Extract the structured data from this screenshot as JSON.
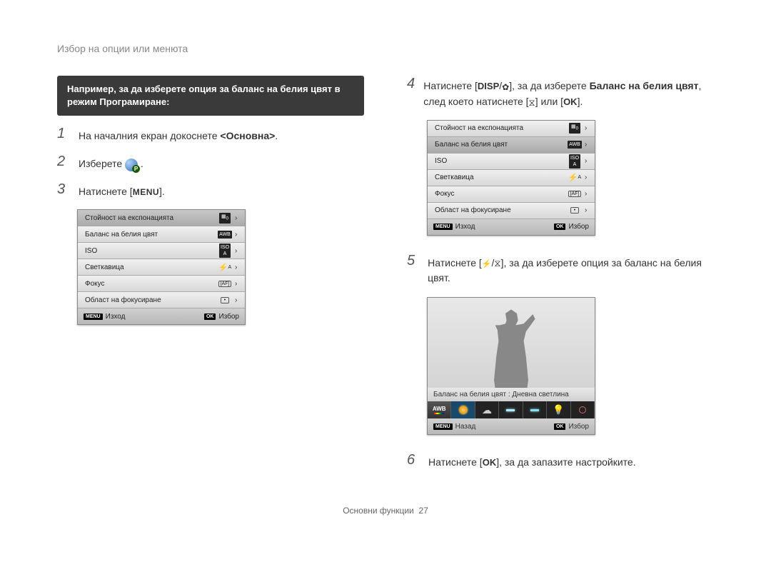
{
  "header": "Избор на опции или менюта",
  "note": "Например, за да изберете опция за баланс на белия цвят в режим Програмиране:",
  "steps": {
    "s1": {
      "num": "1",
      "text_a": "На началния екран докоснете ",
      "bold": "<Основна>",
      "text_b": "."
    },
    "s2": {
      "num": "2",
      "text_a": "Изберете ",
      "text_b": "."
    },
    "s3": {
      "num": "3",
      "text_a": "Натиснете [",
      "menu": "MENU",
      "text_b": "]."
    },
    "s4": {
      "num": "4",
      "text_a": "Натиснете [",
      "disp": "DISP",
      "slash": "/",
      "text_b": "], за да изберете ",
      "bold": "Баланс на белия цвят",
      "text_c": ", след което натиснете [",
      "text_d": "] или [",
      "ok": "OK",
      "text_e": "]."
    },
    "s5": {
      "num": "5",
      "text_a": "Натиснете [",
      "slash": "/",
      "text_b": "], за да изберете опция за баланс на белия цвят."
    },
    "s6": {
      "num": "6",
      "text_a": "Натиснете [",
      "ok": "OK",
      "text_b": "], за да запазите настройките."
    }
  },
  "menu": {
    "r1": "Стойност на експонацията",
    "r2": "Баланс на белия цвят",
    "r3": "ISO",
    "r4": "Светкавица",
    "r5": "Фокус",
    "r6": "Област на фокусиране",
    "v3": "ISO",
    "v_auto_sup": "A",
    "footer_menu": "MENU",
    "footer_exit": "Изход",
    "footer_ok": "OK",
    "footer_select": "Избор",
    "footer_back": "Назад"
  },
  "preview": {
    "label_prefix": "Баланс на белия цвят : ",
    "label_value": "Дневна светлина",
    "awb_top": "AWB"
  },
  "footer": {
    "label": "Основни функции",
    "page": "27"
  }
}
